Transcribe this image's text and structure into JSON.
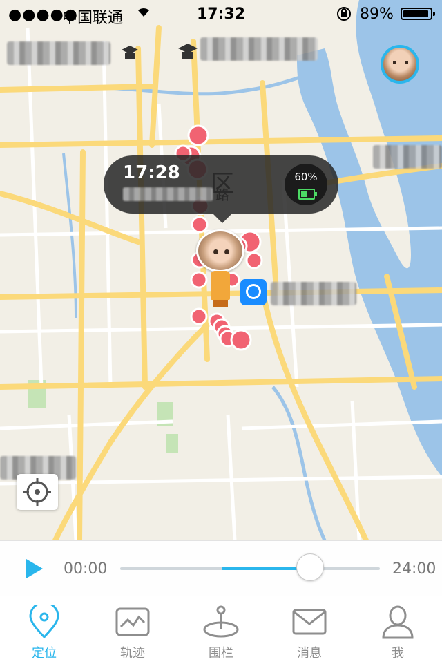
{
  "status_bar": {
    "signal": "●●●●●",
    "carrier": "中国联通",
    "time": "17:32",
    "battery_percent": "89%"
  },
  "map": {
    "district_char": "区",
    "road_suffix_char": "路",
    "colors": {
      "water": "#9cc4e8",
      "road_major": "#fbd97a",
      "road_minor": "#ffffff",
      "park": "#c5e4b6",
      "track_point": "#f16372"
    }
  },
  "callout": {
    "time": "17:28",
    "battery_percent": "60%",
    "battery_level": 0.6
  },
  "timeline": {
    "start_time": "00:00",
    "end_time": "24:00",
    "progress": 0.73,
    "played_segment": [
      0.39,
      0.73
    ]
  },
  "tabs": [
    {
      "label": "定位",
      "icon": "location-pin-icon",
      "active": true
    },
    {
      "label": "轨迹",
      "icon": "track-chart-icon",
      "active": false
    },
    {
      "label": "围栏",
      "icon": "geofence-icon",
      "active": false
    },
    {
      "label": "消息",
      "icon": "envelope-icon",
      "active": false
    },
    {
      "label": "我",
      "icon": "person-icon",
      "active": false
    }
  ]
}
